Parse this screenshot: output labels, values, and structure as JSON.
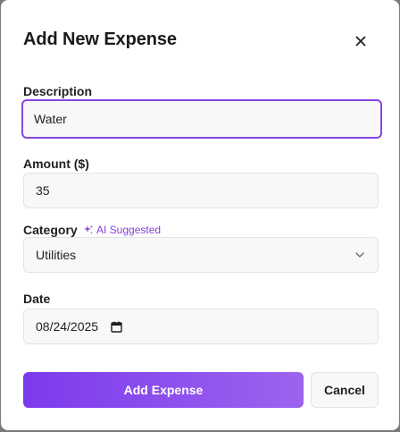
{
  "modal": {
    "title": "Add New Expense",
    "close_icon": "close-icon"
  },
  "form": {
    "description": {
      "label": "Description",
      "value": "Water"
    },
    "amount": {
      "label": "Amount ($)",
      "value": "35"
    },
    "category": {
      "label": "Category",
      "ai_badge": "AI Suggested",
      "ai_icon": "sparkle-icon",
      "value": "Utilities",
      "dropdown_icon": "chevron-down-icon"
    },
    "date": {
      "label": "Date",
      "value": "08/24/2025",
      "picker_icon": "calendar-icon"
    }
  },
  "actions": {
    "submit_label": "Add Expense",
    "cancel_label": "Cancel"
  },
  "colors": {
    "accent": "#7c3aed",
    "accent_light": "#9d63ee",
    "badge": "#8a3fd6"
  }
}
